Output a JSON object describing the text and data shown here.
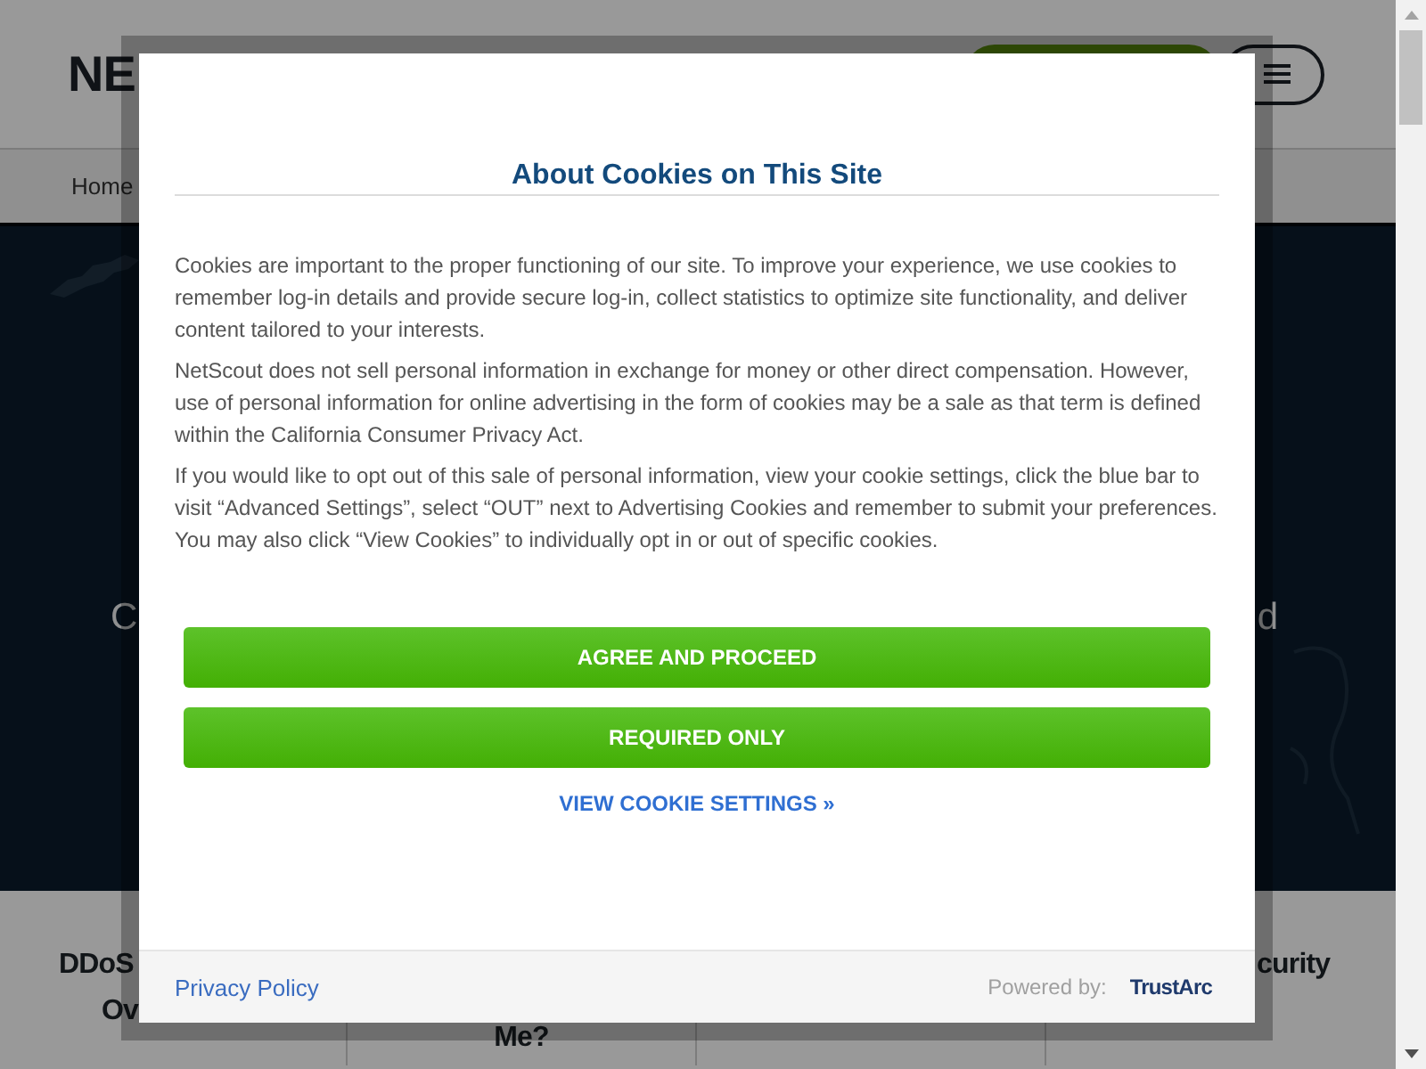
{
  "header": {
    "logo": "NE"
  },
  "breadcrumb": [
    "Home"
  ],
  "hero": {
    "left_fragment": "C",
    "right_fragment": "d"
  },
  "cards": {
    "card_1": {
      "lines": [
        "DDoS",
        "Ov"
      ]
    },
    "card_2": {
      "lines": [
        "Me?"
      ]
    },
    "card_4": {
      "lines": [
        "curity"
      ]
    }
  },
  "cookie_dialog": {
    "title": "About Cookies on This Site",
    "paragraphs": [
      "Cookies are important to the proper functioning of our site. To improve your experience, we use cookies to remember log-in details and provide secure log-in, collect statistics to optimize site functionality, and deliver content tailored to your interests.",
      "NetScout does not sell personal information in exchange for money or other direct compensation. However, use of personal information for online advertising in the form of cookies may be a sale as that term is defined within the California Consumer Privacy Act.",
      "If you would like to opt out of this sale of personal information, view your cookie settings, click the blue bar to visit “Advanced Settings”, select “OUT” next to Advertising Cookies and remember to submit your preferences. You may also click “View Cookies” to individually opt in or out of specific cookies."
    ],
    "buttons": [
      "AGREE AND PROCEED",
      "REQUIRED ONLY"
    ],
    "settings_link": "VIEW COOKIE SETTINGS »",
    "footer": {
      "privacy_link": "Privacy Policy",
      "powered_by": "Powered by:",
      "logo": "TrustArc"
    }
  }
}
